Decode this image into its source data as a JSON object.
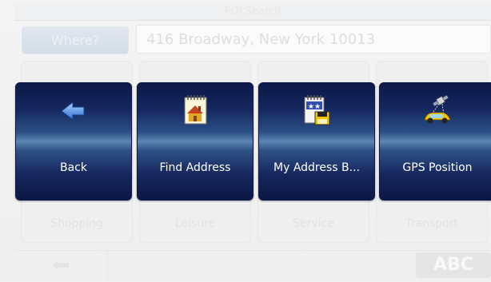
{
  "background_screen": {
    "title": "POI Search",
    "where_button": "Where?",
    "address": "416 Broadway, New York 10013",
    "categories": [
      "Shopping",
      "Leisure",
      "Service",
      "Transport"
    ],
    "bottom_back_icon": "back-arrow-icon",
    "abc_button": "ABC"
  },
  "menu": {
    "items": [
      {
        "label": "Back",
        "icon": "back-arrow-icon"
      },
      {
        "label": "Find Address",
        "icon": "notepad-house-icon"
      },
      {
        "label": "My Address B...",
        "icon": "address-book-save-icon"
      },
      {
        "label": "GPS Position",
        "icon": "satellite-car-icon"
      }
    ]
  },
  "colors": {
    "button_dark": "#0c1848",
    "button_highlight": "#5d86b2",
    "label_text": "#ffffff"
  }
}
